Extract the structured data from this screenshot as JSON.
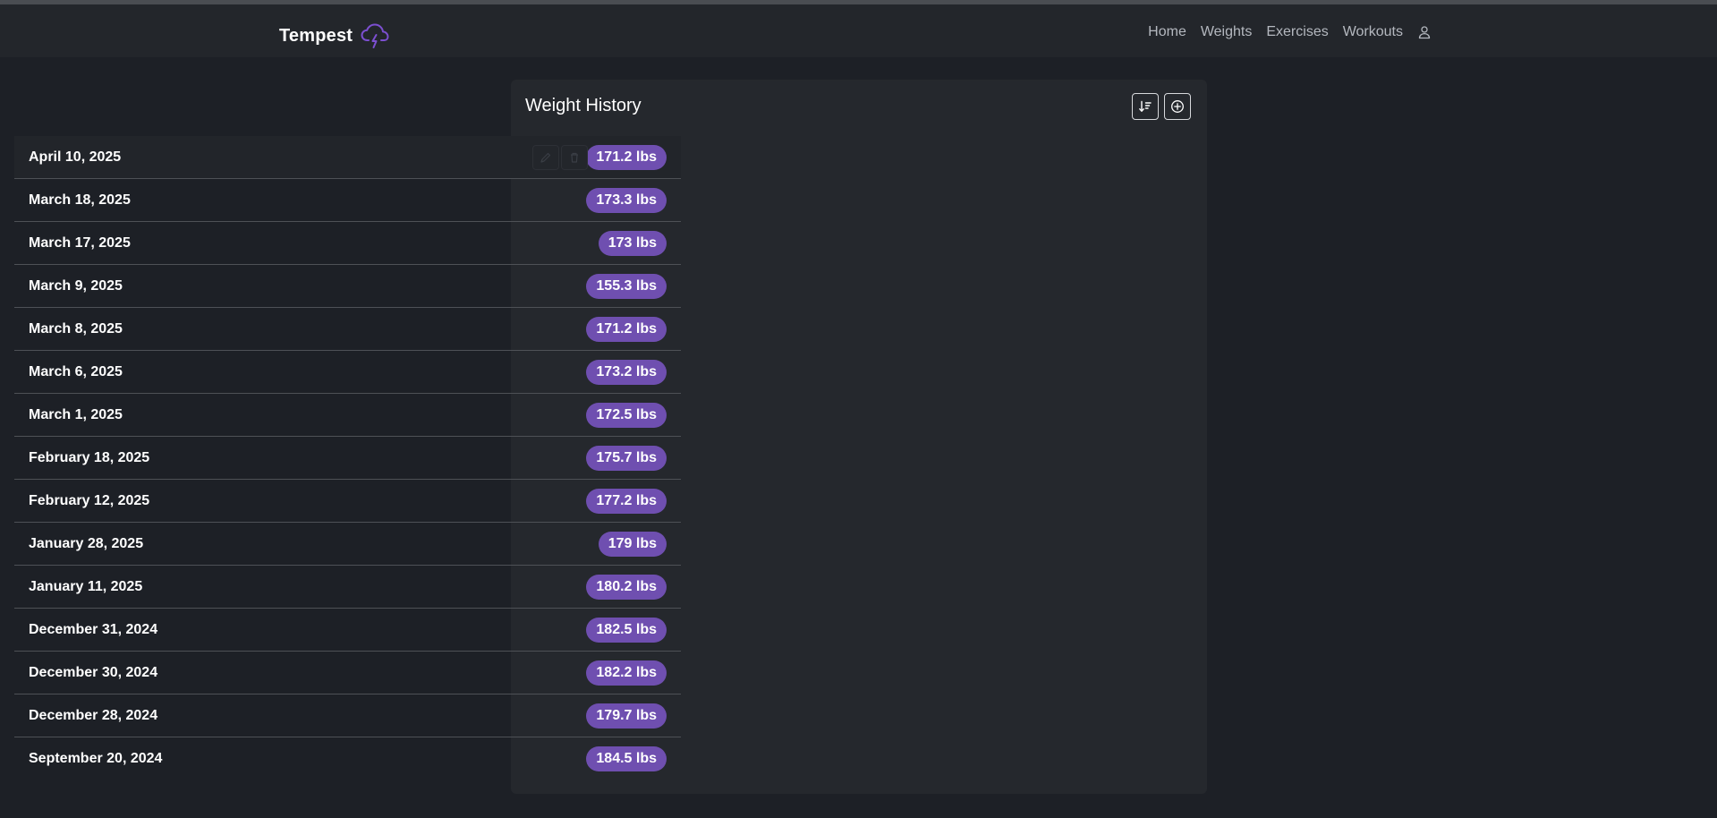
{
  "app": {
    "name": "Tempest"
  },
  "nav": {
    "items": [
      "Home",
      "Weights",
      "Exercises",
      "Workouts"
    ]
  },
  "card": {
    "title": "Weight History"
  },
  "entries": [
    {
      "date": "April 10, 2025",
      "weight": "171.2 lbs"
    },
    {
      "date": "March 18, 2025",
      "weight": "173.3 lbs"
    },
    {
      "date": "March 17, 2025",
      "weight": "173 lbs"
    },
    {
      "date": "March 9, 2025",
      "weight": "155.3 lbs"
    },
    {
      "date": "March 8, 2025",
      "weight": "171.2 lbs"
    },
    {
      "date": "March 6, 2025",
      "weight": "173.2 lbs"
    },
    {
      "date": "March 1, 2025",
      "weight": "172.5 lbs"
    },
    {
      "date": "February 18, 2025",
      "weight": "175.7 lbs"
    },
    {
      "date": "February 12, 2025",
      "weight": "177.2 lbs"
    },
    {
      "date": "January 28, 2025",
      "weight": "179 lbs"
    },
    {
      "date": "January 11, 2025",
      "weight": "180.2 lbs"
    },
    {
      "date": "December 31, 2024",
      "weight": "182.5 lbs"
    },
    {
      "date": "December 30, 2024",
      "weight": "182.2 lbs"
    },
    {
      "date": "December 28, 2024",
      "weight": "179.7 lbs"
    },
    {
      "date": "September 20, 2024",
      "weight": "184.5 lbs"
    }
  ],
  "colors": {
    "background": "#1d2026",
    "navbar": "#23262b",
    "card": "#25282d",
    "badge": "#6f4fb0",
    "brand_icon": "#7c4fd0"
  },
  "icons": {
    "brand": "cloud-lightning-icon",
    "user": "person-icon",
    "sort": "sort-descending-icon",
    "add": "plus-circle-icon",
    "edit": "pencil-icon",
    "delete": "trash-icon"
  }
}
